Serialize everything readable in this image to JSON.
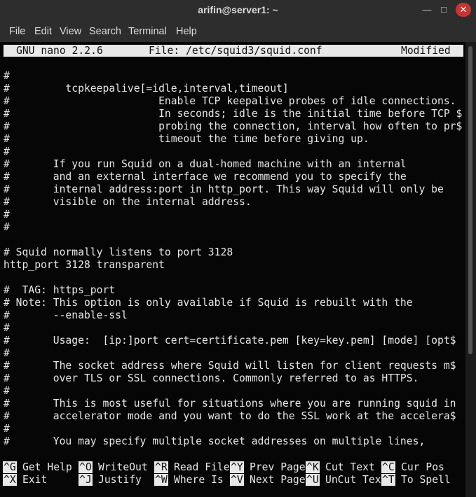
{
  "window": {
    "title": "arifin@server1: ~",
    "minimize_glyph": "—",
    "maximize_glyph": "□",
    "close_glyph": "✕"
  },
  "menu": [
    "File",
    "Edit",
    "View",
    "Search",
    "Terminal",
    "Help"
  ],
  "nano": {
    "version": "GNU nano 2.2.6",
    "file": "File: /etc/squid3/squid.conf",
    "status": "Modified"
  },
  "lines": [
    "#",
    "#         tcpkeepalive[=idle,interval,timeout]",
    "#                        Enable TCP keepalive probes of idle connections.",
    "#                        In seconds; idle is the initial time before TCP $",
    "#                        probing the connection, interval how often to pr$",
    "#                        timeout the time before giving up.",
    "#",
    "#       If you run Squid on a dual-homed machine with an internal",
    "#       and an external interface we recommend you to specify the",
    "#       internal address:port in http_port. This way Squid will only be",
    "#       visible on the internal address.",
    "#",
    "#",
    "",
    "# Squid normally listens to port 3128",
    "http_port 3128 transparent",
    "",
    "#  TAG: https_port",
    "# Note: This option is only available if Squid is rebuilt with the",
    "#       --enable-ssl",
    "#",
    "#       Usage:  [ip:]port cert=certificate.pem [key=key.pem] [mode] [opt$",
    "#",
    "#       The socket address where Squid will listen for client requests m$",
    "#       over TLS or SSL connections. Commonly referred to as HTTPS.",
    "#",
    "#       This is most useful for situations where you are running squid in",
    "#       accelerator mode and you want to do the SSL work at the accelera$",
    "#",
    "#       You may specify multiple socket addresses on multiple lines,"
  ],
  "shortcuts_row1": [
    {
      "key": "^G",
      "label": "Get Help"
    },
    {
      "key": "^O",
      "label": "WriteOut"
    },
    {
      "key": "^R",
      "label": "Read File"
    },
    {
      "key": "^Y",
      "label": "Prev Page"
    },
    {
      "key": "^K",
      "label": "Cut Text"
    },
    {
      "key": "^C",
      "label": "Cur Pos"
    }
  ],
  "shortcuts_row2": [
    {
      "key": "^X",
      "label": "Exit"
    },
    {
      "key": "^J",
      "label": "Justify"
    },
    {
      "key": "^W",
      "label": "Where Is"
    },
    {
      "key": "^V",
      "label": "Next Page"
    },
    {
      "key": "^U",
      "label": "UnCut Text"
    },
    {
      "key": "^T",
      "label": "To Spell"
    }
  ]
}
